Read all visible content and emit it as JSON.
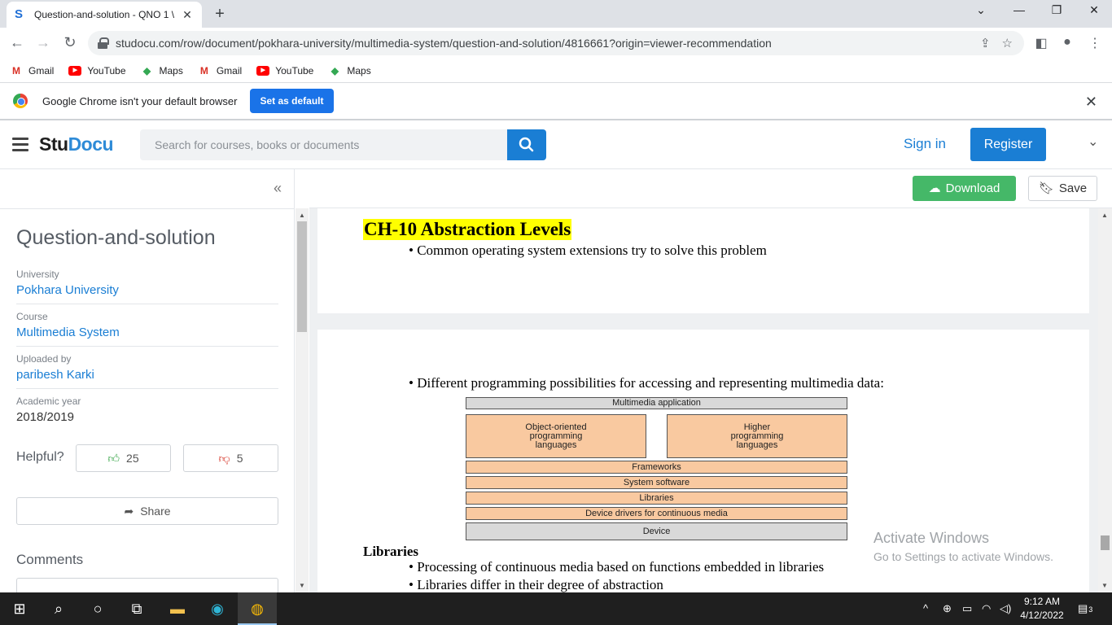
{
  "browser": {
    "tab_title": "Question-and-solution - QNO 1 \\",
    "tab_favicon": "S",
    "url": "studocu.com/row/document/pokhara-university/multimedia-system/question-and-solution/4816661?origin=viewer-recommendation",
    "bookmarks": [
      {
        "label": "Gmail",
        "icon": "gmail-icon"
      },
      {
        "label": "YouTube",
        "icon": "youtube-icon"
      },
      {
        "label": "Maps",
        "icon": "maps-icon"
      },
      {
        "label": "Gmail",
        "icon": "gmail-icon"
      },
      {
        "label": "YouTube",
        "icon": "youtube-icon"
      },
      {
        "label": "Maps",
        "icon": "maps-icon"
      }
    ],
    "infobar_text": "Google Chrome isn't your default browser",
    "infobar_button": "Set as default"
  },
  "header": {
    "logo_stu": "Stu",
    "logo_docu": "Docu",
    "search_placeholder": "Search for courses, books or documents",
    "signin": "Sign in",
    "register": "Register"
  },
  "sidebar": {
    "collapse_glyph": "«",
    "title": "Question-and-solution",
    "meta": [
      {
        "label": "University",
        "value": "Pokhara University"
      },
      {
        "label": "Course",
        "value": "Multimedia System"
      },
      {
        "label": "Uploaded by",
        "value": "paribesh Karki"
      },
      {
        "label": "Academic year",
        "value": "2018/2019"
      }
    ],
    "helpful_label": "Helpful?",
    "upvotes": "25",
    "downvotes": "5",
    "share": "Share",
    "comments": "Comments"
  },
  "actions": {
    "download": "Download",
    "save": "Save"
  },
  "document": {
    "ch_title": "CH-10 Abstraction Levels",
    "bullet_p1": "• Common operating system extensions try to solve this problem",
    "bullet_p2": "• Different programming possibilities for accessing and representing multimedia data:",
    "diagram": {
      "top": "Multimedia application",
      "left_box_lines": [
        "Object-oriented",
        "programming",
        "languages"
      ],
      "right_box_lines": [
        "Higher",
        "programming",
        "languages"
      ],
      "layers": [
        "Frameworks",
        "System software",
        "Libraries",
        "Device drivers for continuous media"
      ],
      "bottom": "Device"
    },
    "lib_heading": "Libraries",
    "lib_bullets": [
      "• Processing of continuous media based on functions embedded in libraries",
      "• Libraries differ in their degree of abstraction"
    ]
  },
  "watermark": {
    "line1": "Activate Windows",
    "line2": "Go to Settings to activate Windows."
  },
  "taskbar": {
    "time": "9:12 AM",
    "date": "4/12/2022",
    "notifications": "3"
  },
  "colors": {
    "studocu_blue": "#1a7ed4",
    "download_green": "#45b868",
    "highlight_yellow": "#ffff00",
    "diagram_orange": "#f9c9a0",
    "diagram_grey": "#d9d9d9"
  }
}
